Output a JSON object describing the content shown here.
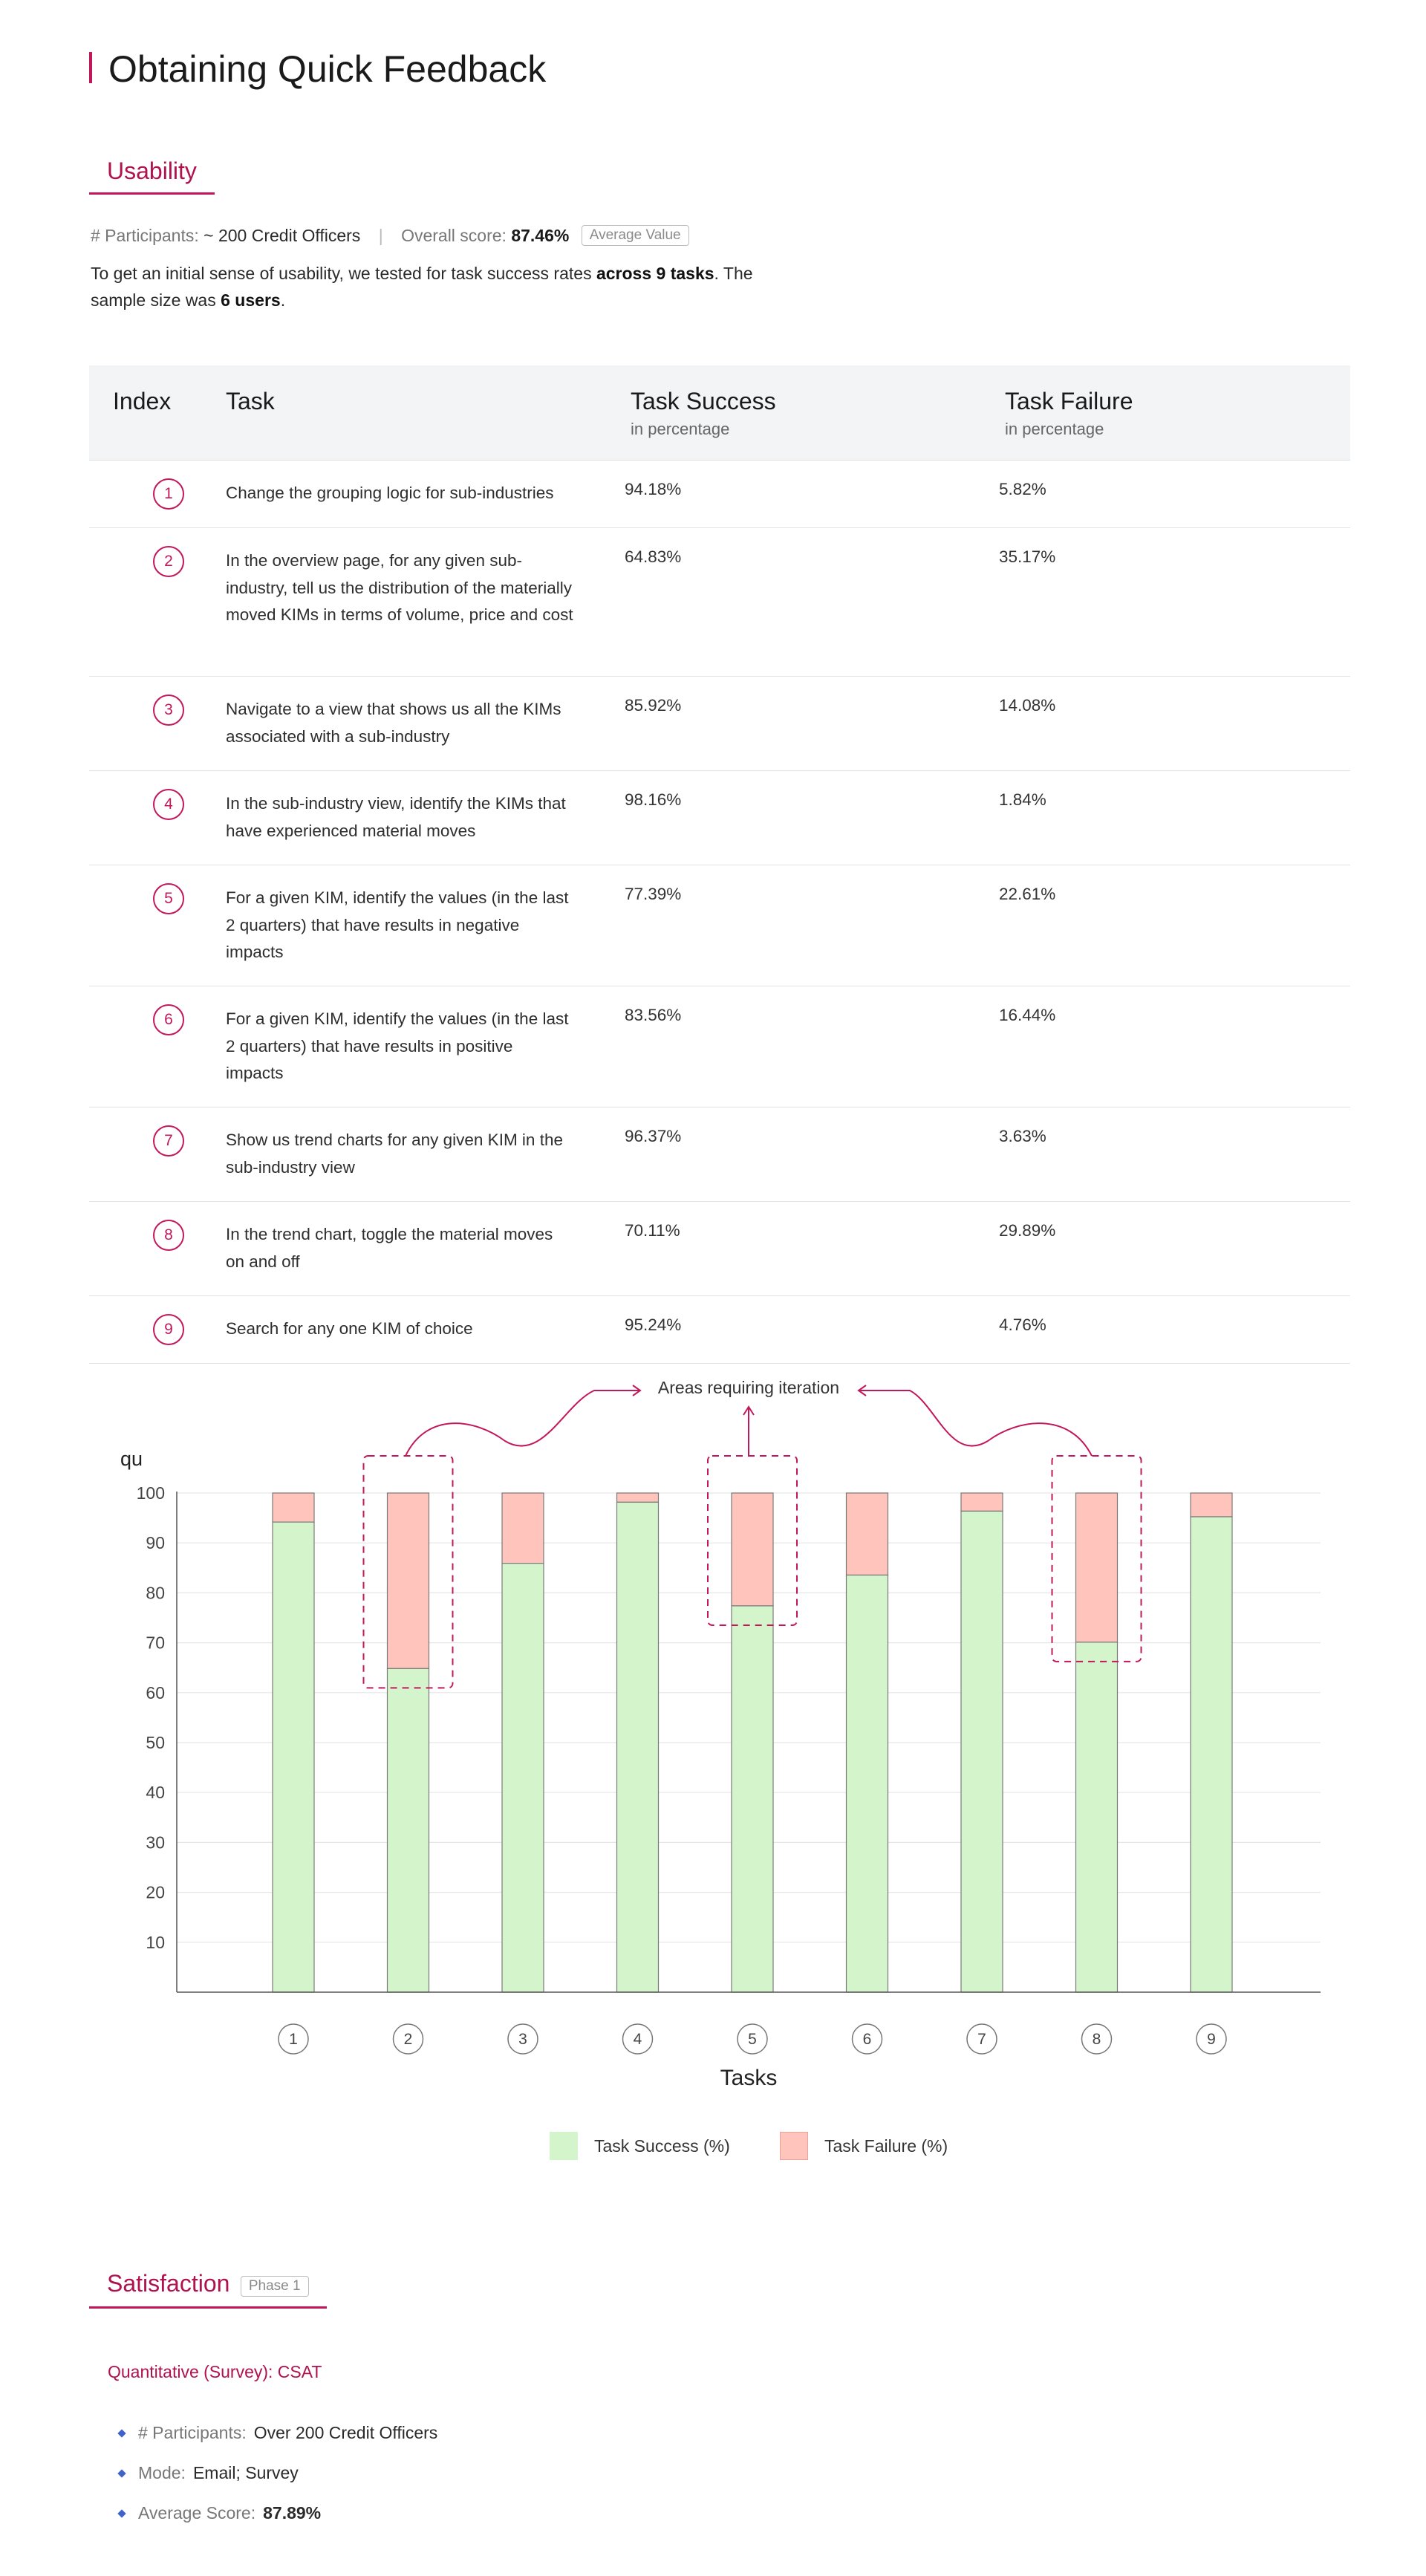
{
  "page_title": "Obtaining Quick Feedback",
  "usability": {
    "heading": "Usability",
    "participants_label": "# Participants:",
    "participants_value": "~ 200 Credit Officers",
    "overall_label": "Overall score:",
    "overall_value": "87.46%",
    "overall_badge": "Average Value",
    "intro_pre": "To get an initial sense of usability, we tested for task success rates ",
    "intro_bold1": "across 9 tasks",
    "intro_mid": ". The sample size was ",
    "intro_bold2": "6 users",
    "intro_end": "."
  },
  "table": {
    "headers": {
      "index": "Index",
      "task": "Task",
      "success": "Task Success",
      "success_sub": "in percentage",
      "failure": "Task Failure",
      "failure_sub": "in percentage"
    },
    "rows": [
      {
        "index": "1",
        "task": "Change the grouping logic for sub-industries",
        "success": "94.18%",
        "failure": "5.82%"
      },
      {
        "index": "2",
        "task": "In the overview page, for any given sub-industry, tell us the distribution of the materially moved KIMs in terms of volume, price and cost",
        "success": "64.83%",
        "failure": "35.17%"
      },
      {
        "index": "3",
        "task": "Navigate to a view that shows us all the KIMs associated with a sub-industry",
        "success": "85.92%",
        "failure": "14.08%"
      },
      {
        "index": "4",
        "task": "In the sub-industry view, identify the KIMs that have experienced material moves",
        "success": "98.16%",
        "failure": "1.84%"
      },
      {
        "index": "5",
        "task": "For a given KIM, identify the values (in the last 2 quarters) that have results in negative impacts",
        "success": "77.39%",
        "failure": "22.61%"
      },
      {
        "index": "6",
        "task": "For a given KIM, identify the values (in the last 2 quarters) that have results in positive impacts",
        "success": "83.56%",
        "failure": "16.44%"
      },
      {
        "index": "7",
        "task": "Show us trend charts for any given KIM in the sub-industry view",
        "success": "96.37%",
        "failure": "3.63%"
      },
      {
        "index": "8",
        "task": "In the trend chart, toggle the material moves on and off",
        "success": "70.11%",
        "failure": "29.89%"
      },
      {
        "index": "9",
        "task": "Search for any one KIM of choice",
        "success": "95.24%",
        "failure": "4.76%"
      }
    ]
  },
  "chart_data": {
    "type": "bar",
    "stacked": true,
    "title": "",
    "ylabel": "qu",
    "xlabel": "Tasks",
    "ylim": [
      0,
      100
    ],
    "yticks": [
      10,
      20,
      30,
      40,
      50,
      60,
      70,
      80,
      90,
      100
    ],
    "grid": true,
    "categories": [
      "1",
      "2",
      "3",
      "4",
      "5",
      "6",
      "7",
      "8",
      "9"
    ],
    "series": [
      {
        "name": "Task Success (%)",
        "color": "#d4f4cc",
        "values": [
          94.18,
          64.83,
          85.92,
          98.16,
          77.39,
          83.56,
          96.37,
          70.11,
          95.24
        ]
      },
      {
        "name": "Task Failure (%)",
        "color": "#ffc4bc",
        "values": [
          5.82,
          35.17,
          14.08,
          1.84,
          22.61,
          16.44,
          3.63,
          29.89,
          4.76
        ]
      }
    ],
    "annotation": {
      "text": "Areas requiring iteration",
      "highlighted": [
        "2",
        "5",
        "8"
      ]
    },
    "legend": "bottom"
  },
  "satisfaction": {
    "heading": "Satisfaction",
    "badge": "Phase 1",
    "subheading": "Quantitative (Survey): CSAT",
    "items": [
      {
        "label": "# Participants:",
        "value": "Over 200 Credit Officers"
      },
      {
        "label": "Mode:",
        "value": "Email; Survey"
      },
      {
        "label": "Average Score:",
        "value": "87.89%"
      }
    ]
  },
  "colors": {
    "accent": "#c2185b",
    "success": "#d4f4cc",
    "failure": "#ffc4bc",
    "bullet": "#3f63c9"
  }
}
